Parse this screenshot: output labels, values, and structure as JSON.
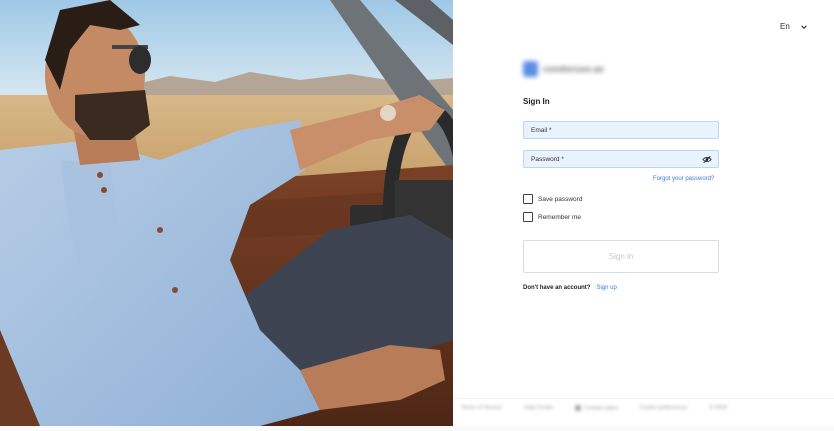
{
  "language": {
    "label": "En",
    "icon": "chevron-down-icon"
  },
  "logo": {
    "text": "condoruse.ae",
    "icon": "brand-logo-icon",
    "color": "#3f7be0"
  },
  "form": {
    "title": "Sign In",
    "email": {
      "label": "Email *",
      "value": ""
    },
    "password": {
      "label": "Password *",
      "value": "",
      "toggle_icon": "eye-off-icon"
    },
    "forgot_link": "Forgot your password?",
    "save_password": {
      "label": "Save password",
      "checked": false
    },
    "remember_me": {
      "label": "Remember me",
      "checked": false
    },
    "submit_label": "Sign in",
    "signup_prompt": "Don't have an account?",
    "signup_link": "Sign up"
  },
  "footer": {
    "items": [
      "Terms of Service",
      "Help Center",
      "Contact sales",
      "Cookie preferences",
      "© 2024"
    ]
  },
  "colors": {
    "accent": "#3b7bd6",
    "input_bg": "#e9f3fd",
    "input_border": "#bcd6ef"
  }
}
